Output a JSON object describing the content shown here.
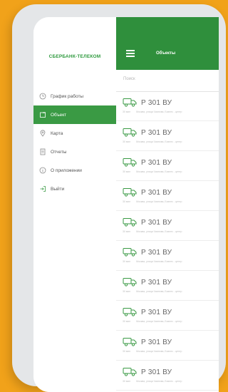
{
  "drawer": {
    "brand": "СБЕРБАНК-ТЕЛЕКОМ",
    "items": [
      {
        "label": "График работы",
        "icon": "clock-icon",
        "active": false
      },
      {
        "label": "Объект",
        "icon": "object-icon",
        "active": true
      },
      {
        "label": "Карта",
        "icon": "map-pin-icon",
        "active": false
      },
      {
        "label": "Отчеты",
        "icon": "report-icon",
        "active": false
      },
      {
        "label": "О приложении",
        "icon": "info-icon",
        "active": false
      },
      {
        "label": "Выйти",
        "icon": "logout-icon",
        "active": false
      }
    ]
  },
  "header": {
    "title": "Объекты"
  },
  "search": {
    "placeholder": "Поиск"
  },
  "objects": [
    {
      "plate": "Р 301 ВУ",
      "time": "30 мин",
      "address": "Москва, улица Чаянова, Бизнес - центр"
    },
    {
      "plate": "Р 301 ВУ",
      "time": "30 мин",
      "address": "Москва, улица Чаянова, Бизнес - центр"
    },
    {
      "plate": "Р 301 ВУ",
      "time": "30 мин",
      "address": "Москва, улица Чаянова, Бизнес - центр"
    },
    {
      "plate": "Р 301 ВУ",
      "time": "30 мин",
      "address": "Москва, улица Чаянова, Бизнес - центр"
    },
    {
      "plate": "Р 301 ВУ",
      "time": "30 мин",
      "address": "Москва, улица Чаянова, Бизнес - центр"
    },
    {
      "plate": "Р 301 ВУ",
      "time": "30 мин",
      "address": "Москва, улица Чаянова, Бизнес - центр"
    },
    {
      "plate": "Р 301 ВУ",
      "time": "30 мин",
      "address": "Москва, улица Чаянова, Бизнес - центр"
    },
    {
      "plate": "Р 301 ВУ",
      "time": "30 мин",
      "address": "Москва, улица Чаянова, Бизнес - центр"
    },
    {
      "plate": "Р 301 ВУ",
      "time": "30 мин",
      "address": "Москва, улица Чаянова, Бизнес - центр"
    },
    {
      "plate": "Р 301 ВУ",
      "time": "30 мин",
      "address": "Москва, улица Чаянова, Бизнес - центр"
    }
  ],
  "colors": {
    "background": "#f1a21a",
    "brand_green": "#2f8f3c",
    "active_item": "#3a9a44"
  }
}
